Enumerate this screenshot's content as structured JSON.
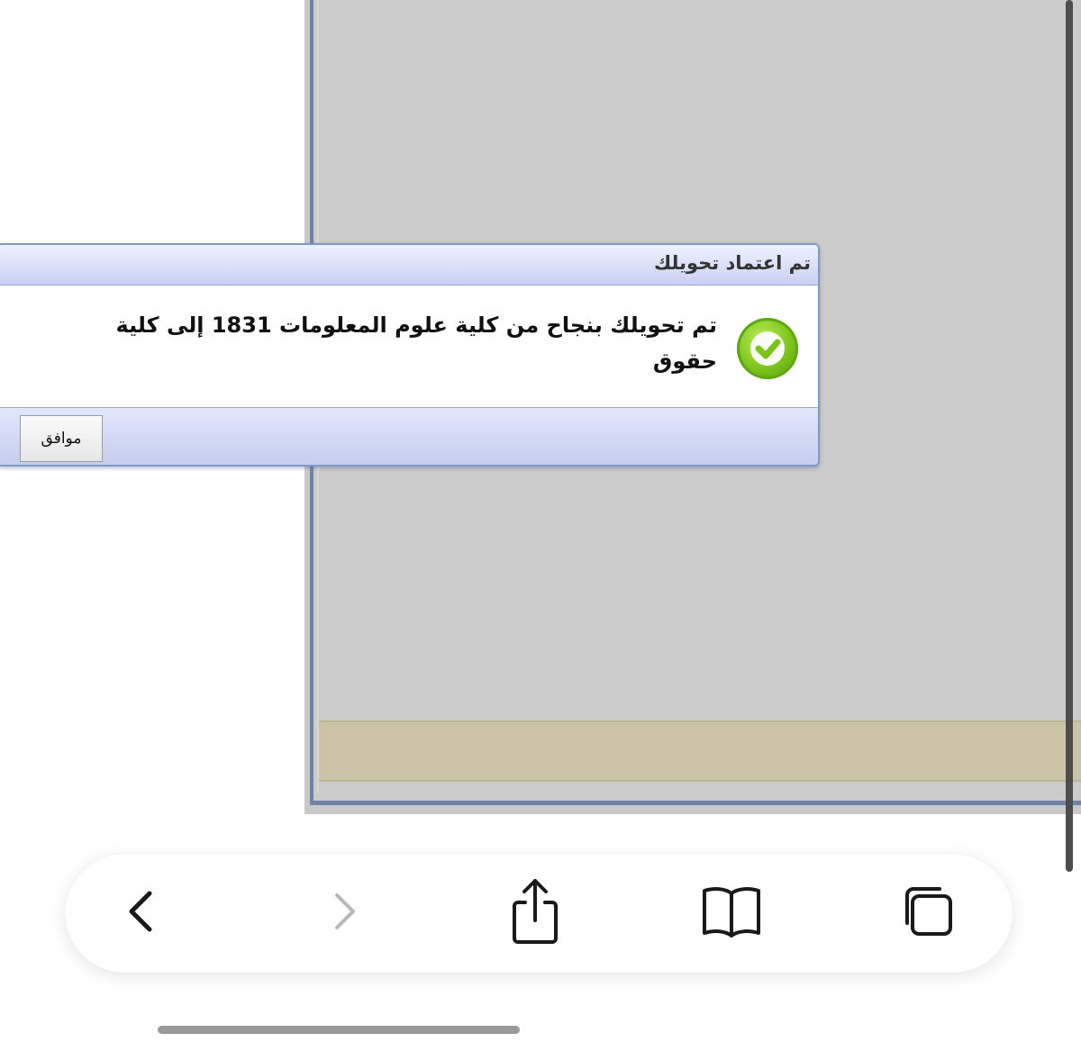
{
  "dialog": {
    "title": "تم اعتماد تحويلك",
    "message": "تم تحويلك بنجاح من كلية علوم المعلومات 1831 إلى كلية حقوق",
    "ok_label": "موافق"
  },
  "toolbar": {
    "icons": [
      "back-icon",
      "forward-icon",
      "share-icon",
      "bookmarks-icon",
      "tabs-icon"
    ]
  },
  "colors": {
    "panel_background": "#c9c9c9",
    "footer_bar": "#cbc4a8",
    "dialog_border": "#7f9ac4",
    "success_green": "#7cc31c"
  }
}
